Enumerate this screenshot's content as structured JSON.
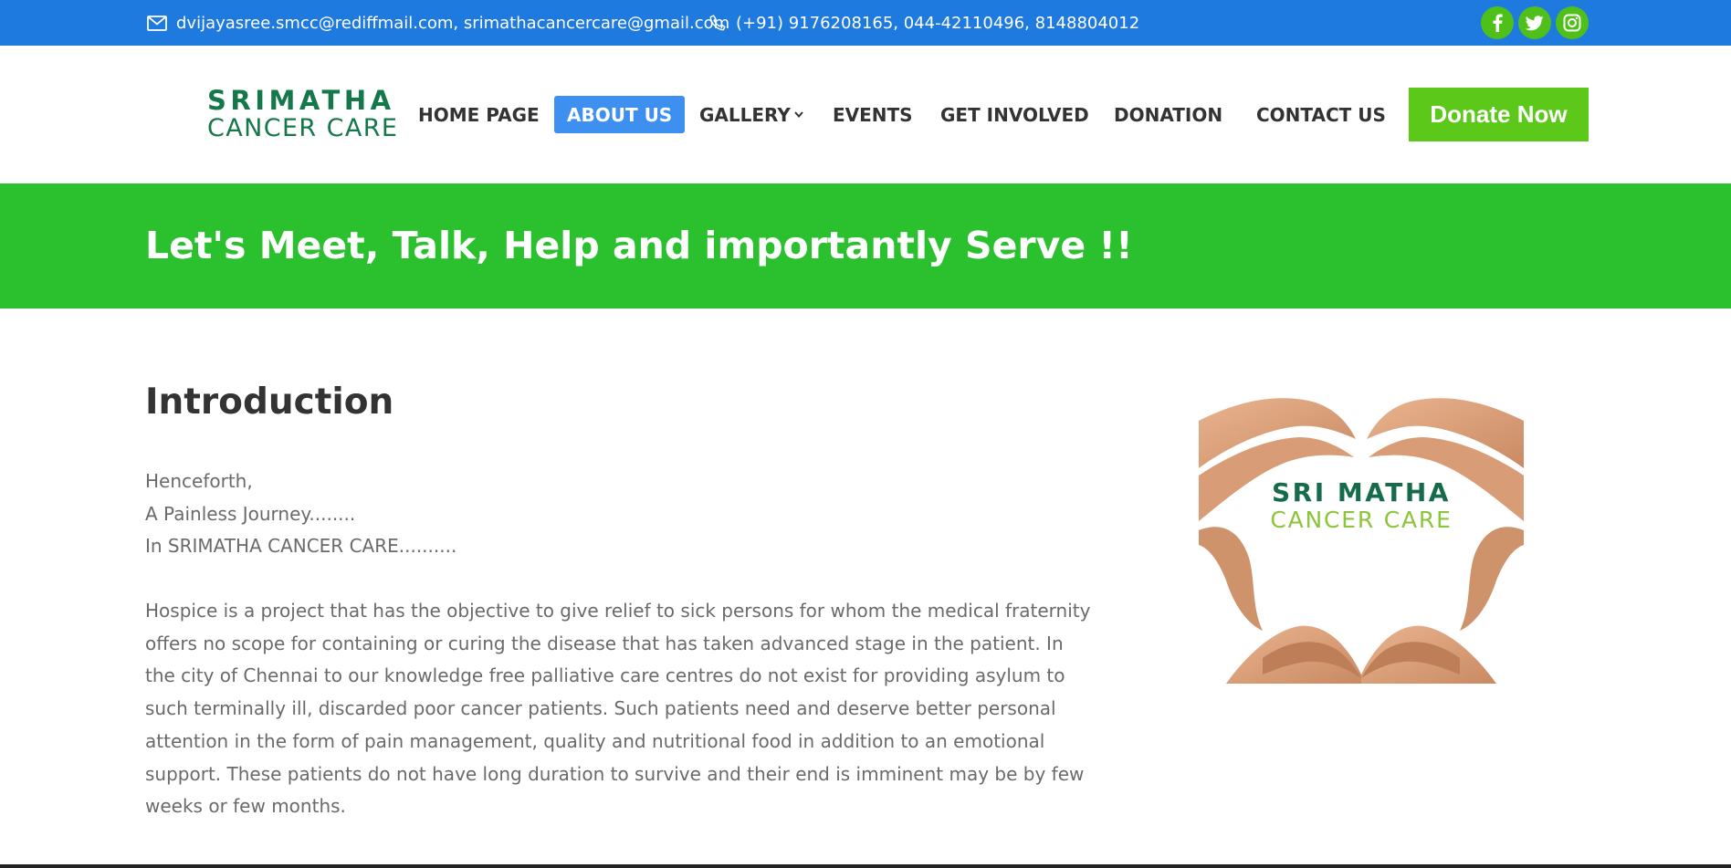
{
  "topbar": {
    "email_text": "dvijayasree.smcc@rediffmail.com, srimathacancercare@gmail.com",
    "phone_text": "(+91) 9176208165, 044-42110496, 8148804012",
    "social": [
      "facebook-icon",
      "twitter-icon",
      "instagram-icon"
    ]
  },
  "logo": {
    "line1": "SRIMATHA",
    "line2": "CANCER CARE"
  },
  "nav": {
    "items": [
      {
        "label": "HOME PAGE"
      },
      {
        "label": "ABOUT US",
        "active": true
      },
      {
        "label": "GALLERY"
      },
      {
        "label": "EVENTS"
      },
      {
        "label": "GET INVOLVED"
      },
      {
        "label": "DONATION"
      },
      {
        "label": "CONTACT US"
      }
    ],
    "donate_label": "Donate Now"
  },
  "banner": {
    "title": "Let's Meet, Talk, Help and importantly Serve !!"
  },
  "content": {
    "heading": "Introduction",
    "lines": [
      "Henceforth,",
      "A Painless Journey........",
      "In SRIMATHA CANCER CARE.........."
    ],
    "paragraph": "Hospice is a project that has the objective to give relief to sick persons for whom the medical fraternity offers no scope for containing or curing the disease that has taken advanced stage in the patient. In the city of Chennai to our knowledge free palliative care centres do not exist for providing asylum to such terminally ill, discarded poor cancer patients. Such patients need and deserve better personal attention in the form of pain management, quality and nutritional food in addition to an emotional support. These patients do not have long duration to survive and their end is imminent may be by few weeks or few months."
  },
  "image": {
    "line1": "SRI MATHA",
    "line2": "CANCER CARE"
  },
  "colors": {
    "topbar": "#1f7ae0",
    "banner": "#2bc02e",
    "donate": "#5cc91a",
    "active_nav": "#3d8ff0",
    "logo_green": "#15784a"
  }
}
